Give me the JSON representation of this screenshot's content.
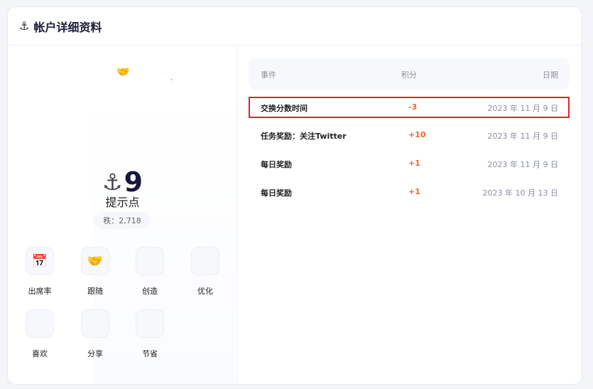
{
  "header": {
    "icon": "anchor-icon",
    "title": "帐户详细资料"
  },
  "profile": {
    "points": "9",
    "points_label": "提示点",
    "rank_text": "秩：2,718"
  },
  "actions": [
    {
      "label": "出席率",
      "icon": "calendar-icon"
    },
    {
      "label": "跟随",
      "icon": "handshake-icon"
    },
    {
      "label": "创造",
      "icon": ""
    },
    {
      "label": "优化",
      "icon": ""
    },
    {
      "label": "喜欢",
      "icon": ""
    },
    {
      "label": "分享",
      "icon": ""
    },
    {
      "label": "节省",
      "icon": ""
    }
  ],
  "table": {
    "headers": {
      "event": "事件",
      "points": "积分",
      "date": "日期"
    },
    "rows": [
      {
        "event": "交换分数时间",
        "points": "-3",
        "date": "2023 年 11 月 9 日",
        "highlighted": true
      },
      {
        "event": "任务奖励：关注Twitter",
        "points": "+10",
        "date": "2023 年 11 月 9 日"
      },
      {
        "event": "每日奖励",
        "points": "+1",
        "date": "2023 年 11 月 9 日"
      },
      {
        "event": "每日奖励",
        "points": "+1",
        "date": "2023 年 10 月 13 日"
      }
    ]
  },
  "colors": {
    "accent_negative": "#f0642d",
    "highlight_border": "#d9262b",
    "title": "#1a1d3a"
  }
}
